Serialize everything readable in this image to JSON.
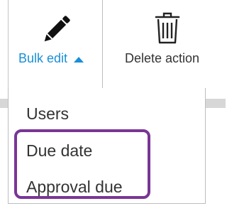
{
  "toolbar": {
    "bulk_edit": {
      "label": "Bulk edit",
      "icon": "pencil-icon",
      "state": "expanded",
      "color": "#1a8fd6"
    },
    "delete_action": {
      "label": "Delete action",
      "icon": "trash-icon"
    }
  },
  "dropdown": {
    "items": [
      {
        "label": "Users"
      },
      {
        "label": "Due date"
      },
      {
        "label": "Approval due"
      }
    ]
  },
  "annotation": {
    "highlight_color": "#7a3596"
  }
}
